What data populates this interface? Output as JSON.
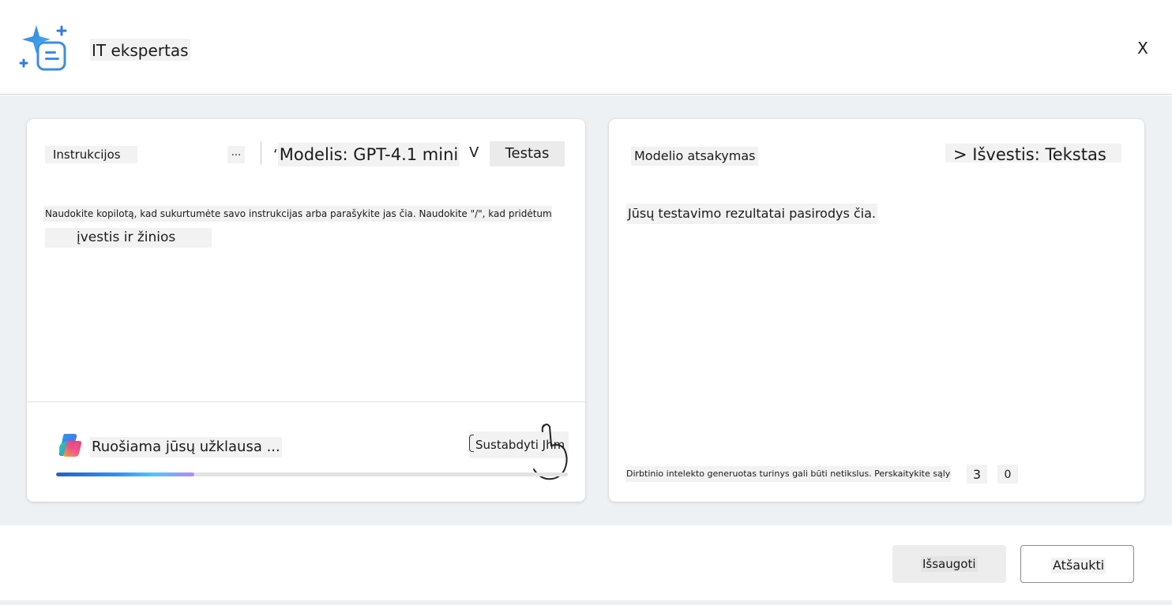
{
  "header": {
    "title": "IT ekspertas",
    "close_label": "X"
  },
  "instructions": {
    "label": "Instrukcijos",
    "more_label": "...",
    "model_quote": "‘",
    "model_label": "Modelis: GPT-4.1 mini",
    "model_chevron": "V",
    "test_label": "Testas",
    "hint_line1": "Naudokite kopilotą, kad sukurtumėte savo instrukcijas arba parašykite jas čia. Naudokite \"/\", kad pridėtumėte",
    "hint_line2": "įvestis ir žinios",
    "status_text": "Ruošiama jūsų užklausa ...",
    "stop_label": "Sustabdyti Jhm",
    "progress_fraction": 0.27
  },
  "response": {
    "label": "Modelio atsakymas",
    "output_label": "> Išvestis: Tekstas",
    "placeholder": "Jūsų testavimo rezultatai pasirodys čia.",
    "disclaimer": "Dirbtinio intelekto generuotas turinys gali būti netikslus. Perskaitykite sąlygas",
    "thumb_up_label": "3",
    "thumb_down_label": "0"
  },
  "footer": {
    "save_label": "Išsaugoti",
    "cancel_label": "Atšaukti"
  },
  "colors": {
    "accent_blue": "#2c5fb8",
    "panel_background": "#eef1f4"
  }
}
